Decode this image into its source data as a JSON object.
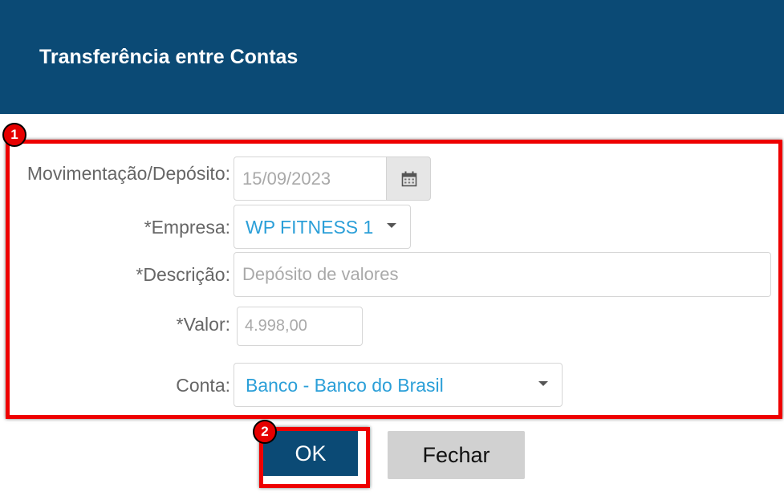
{
  "dialog": {
    "title": "Transferência entre Contas"
  },
  "badges": {
    "step1": "1",
    "step2": "2"
  },
  "form": {
    "movimentacao": {
      "label": "Movimentação/Depósito:",
      "value": "15/09/2023"
    },
    "empresa": {
      "label": "*Empresa:",
      "value": "WP FITNESS 1"
    },
    "descricao": {
      "label": "*Descrição:",
      "placeholder": "Depósito de valores"
    },
    "valor": {
      "label": "*Valor:",
      "placeholder": "4.998,00"
    },
    "conta": {
      "label": "Conta:",
      "value": "Banco - Banco do Brasil"
    }
  },
  "buttons": {
    "ok": "OK",
    "close": "Fechar"
  },
  "icons": {
    "calendar": "calendar-icon",
    "dropdown": "chevron-down-icon"
  },
  "colors": {
    "header": "#0b4a75",
    "highlight": "#ee0000",
    "select_text": "#2b9fd8",
    "ok_button": "#0b4a75",
    "close_button": "#d1d1d1"
  }
}
